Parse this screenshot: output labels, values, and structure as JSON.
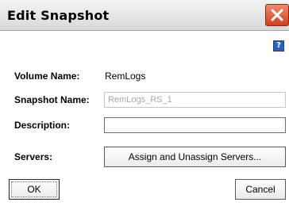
{
  "dialog": {
    "title": "Edit Snapshot",
    "close_icon": "close-x-icon",
    "help_icon_label": "?"
  },
  "fields": {
    "volume_name_label": "Volume Name:",
    "volume_name_value": "RemLogs",
    "snapshot_name_label": "Snapshot Name:",
    "snapshot_name_value": "RemLogs_RS_1",
    "description_label": "Description:",
    "description_value": "",
    "servers_label": "Servers:",
    "assign_button_label": "Assign and Unassign Servers..."
  },
  "buttons": {
    "ok_label": "OK",
    "cancel_label": "Cancel"
  },
  "colors": {
    "close_button": "#d1401f",
    "help_icon": "#2f5fb8"
  }
}
